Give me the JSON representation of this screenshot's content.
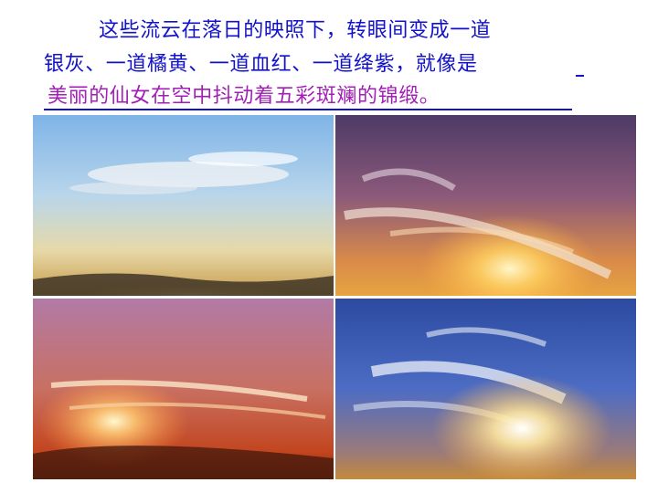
{
  "text": {
    "line1": "这些流云在落日的映照下，转眼间变成一道",
    "line2": "银灰、一道橘黄、一道血红、一道绛紫，就像是",
    "line3": "美丽的仙女在空中抖动着五彩斑斓的锦缎。"
  },
  "colors": {
    "primary_text": "#1212c8",
    "answer_text": "#a21fb6"
  },
  "images": [
    {
      "name": "sunset-silver-clouds"
    },
    {
      "name": "sunset-purple-sky"
    },
    {
      "name": "sunset-red-sky"
    },
    {
      "name": "sunset-blue-sky-clouds"
    }
  ]
}
